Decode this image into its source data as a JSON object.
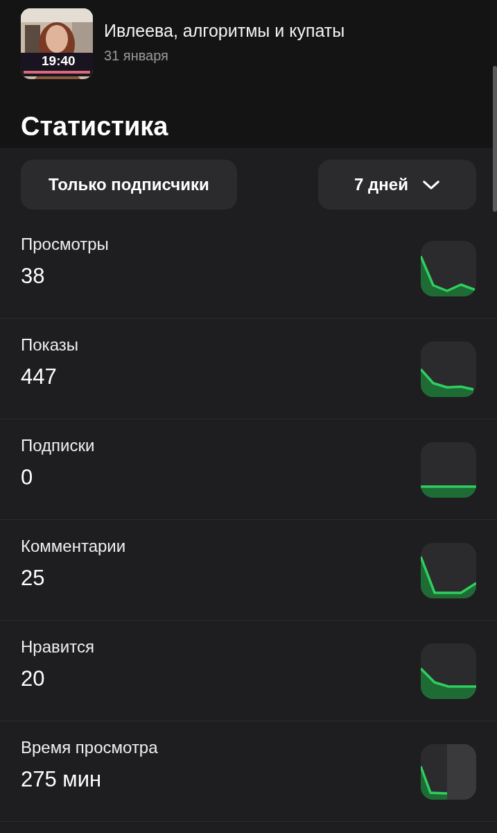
{
  "video": {
    "duration": "19:40",
    "title": "Ивлеева, алгоритмы и купаты",
    "date": "31 января"
  },
  "section_title": "Статистика",
  "filters": {
    "audience": "Только подписчики",
    "period": "7 дней"
  },
  "metrics": [
    {
      "label": "Просмотры",
      "value": "38"
    },
    {
      "label": "Показы",
      "value": "447"
    },
    {
      "label": "Подписки",
      "value": "0"
    },
    {
      "label": "Комментарии",
      "value": "25"
    },
    {
      "label": "Нравится",
      "value": "20"
    },
    {
      "label": "Время просмотра",
      "value": "275 мин"
    }
  ]
}
